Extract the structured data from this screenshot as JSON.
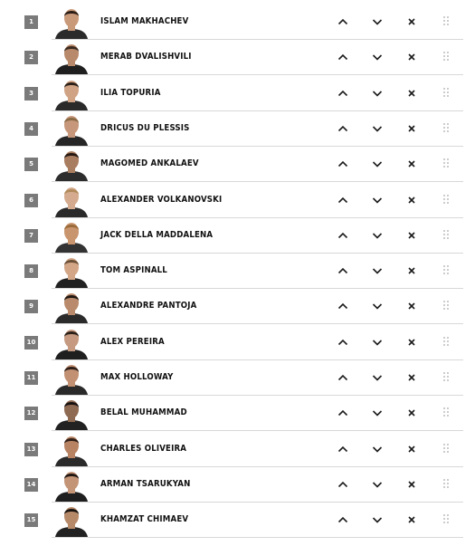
{
  "colors": {
    "badge_bg": "#7a7a7a",
    "divider": "#d8d8d8",
    "text": "#111111",
    "icon": "#1a1a1a",
    "drag_icon": "#bdbdbd"
  },
  "icons": {
    "move_up": "chevron-up-icon",
    "move_down": "chevron-down-icon",
    "remove": "close-icon",
    "drag": "drag-handle-icon",
    "avatar": "fighter-avatar"
  },
  "rankings": [
    {
      "rank": "1",
      "name": "ISLAM MAKHACHEV"
    },
    {
      "rank": "2",
      "name": "MERAB DVALISHVILI"
    },
    {
      "rank": "3",
      "name": "ILIA TOPURIA"
    },
    {
      "rank": "4",
      "name": "DRICUS DU PLESSIS"
    },
    {
      "rank": "5",
      "name": "MAGOMED ANKALAEV"
    },
    {
      "rank": "6",
      "name": "ALEXANDER VOLKANOVSKI"
    },
    {
      "rank": "7",
      "name": "JACK DELLA MADDALENA"
    },
    {
      "rank": "8",
      "name": "TOM ASPINALL"
    },
    {
      "rank": "9",
      "name": "ALEXANDRE PANTOJA"
    },
    {
      "rank": "10",
      "name": "ALEX PEREIRA"
    },
    {
      "rank": "11",
      "name": "MAX HOLLOWAY"
    },
    {
      "rank": "12",
      "name": "BELAL MUHAMMAD"
    },
    {
      "rank": "13",
      "name": "CHARLES OLIVEIRA"
    },
    {
      "rank": "14",
      "name": "ARMAN TSARUKYAN"
    },
    {
      "rank": "15",
      "name": "KHAMZAT CHIMAEV"
    }
  ]
}
